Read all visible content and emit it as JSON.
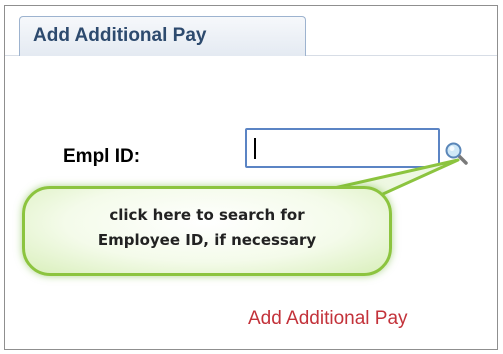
{
  "tab": {
    "label": "Add Additional Pay"
  },
  "form": {
    "empl_id_label": "Empl ID:",
    "empl_id_value": ""
  },
  "callout": {
    "line1": "click here to search for",
    "line2": "Employee ID, if necessary"
  },
  "link": {
    "label": "Add Additional Pay"
  },
  "colors": {
    "tab_text": "#2d4a6e",
    "input_border": "#5b84c4",
    "callout_border": "#8cc43f",
    "link": "#c3323a"
  },
  "icons": {
    "lookup": "search-icon"
  }
}
